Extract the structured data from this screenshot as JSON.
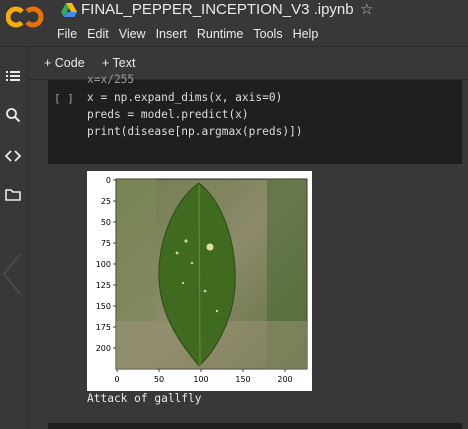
{
  "header": {
    "notebook_title": "FINAL_PEPPER_INCEPTION_V3 .ipynb",
    "menu": [
      "File",
      "Edit",
      "View",
      "Insert",
      "Runtime",
      "Tools",
      "Help"
    ]
  },
  "toolbar": {
    "add_code_label": "+ Code",
    "add_text_label": "+ Text"
  },
  "cell": {
    "execution_marker": "[ ]",
    "lines": [
      "x=x/255",
      "x = np.expand_dims(x, axis=0)",
      "preds = model.predict(x)",
      "print(disease[np.argmax(preds)])"
    ]
  },
  "output": {
    "text": "Attack of gallfly"
  },
  "plot": {
    "y_ticks": [
      "0",
      "25",
      "50",
      "75",
      "100",
      "125",
      "150",
      "175",
      "200"
    ],
    "x_ticks": [
      "0",
      "50",
      "100",
      "150",
      "200"
    ]
  },
  "colors": {
    "logo_orange": "#f9ab00",
    "background": "#383838",
    "cell_background": "#1f1f1f"
  }
}
